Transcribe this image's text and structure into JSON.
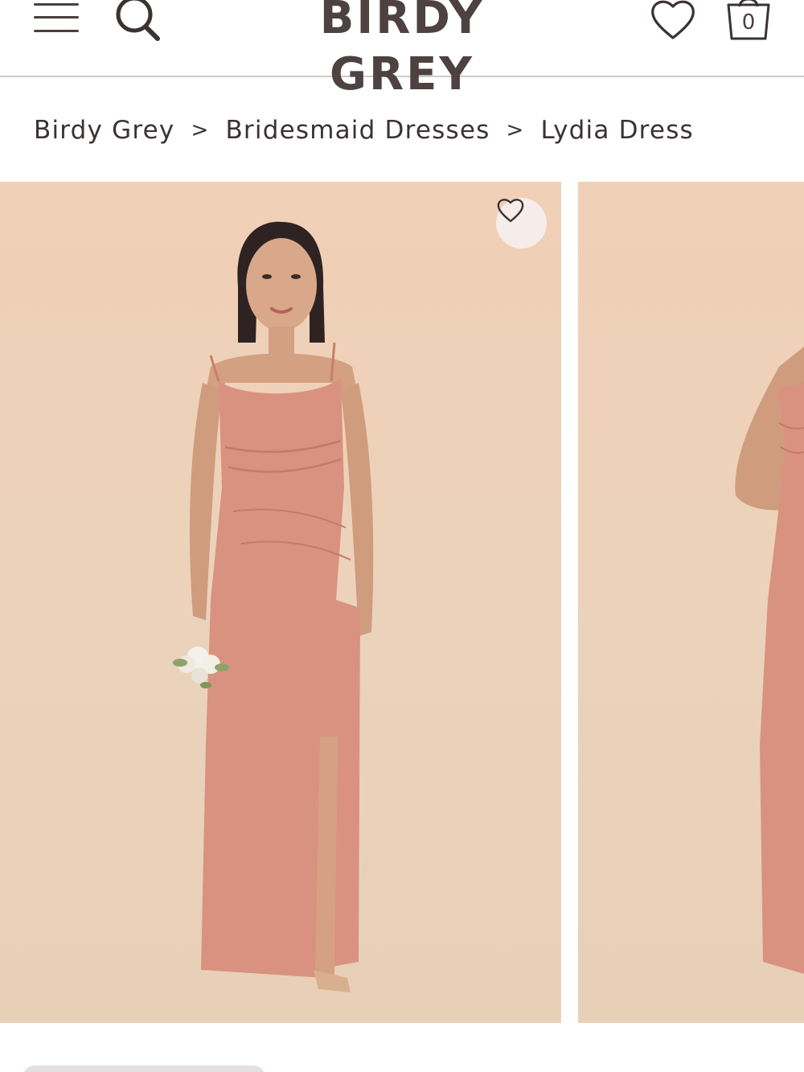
{
  "header": {
    "brand": "BIRDY GREY",
    "menu_icon": "hamburger-menu-icon",
    "search_icon": "search-icon",
    "wishlist_icon": "heart-icon",
    "cart_icon": "shopping-bag-icon",
    "cart_count": "0"
  },
  "breadcrumb": {
    "items": [
      "Birdy Grey",
      "Bridesmaid Dresses",
      "Lydia Dress"
    ],
    "separator": ">"
  },
  "gallery": {
    "favorite_icon": "heart-outline-icon",
    "slides": [
      {
        "subject": "model-full-front"
      },
      {
        "subject": "model-partial"
      }
    ]
  },
  "colors": {
    "text": "#3b3232",
    "background_photo": "#ecd2ba",
    "dress": "#d9927f",
    "divider": "#cfcaca"
  }
}
